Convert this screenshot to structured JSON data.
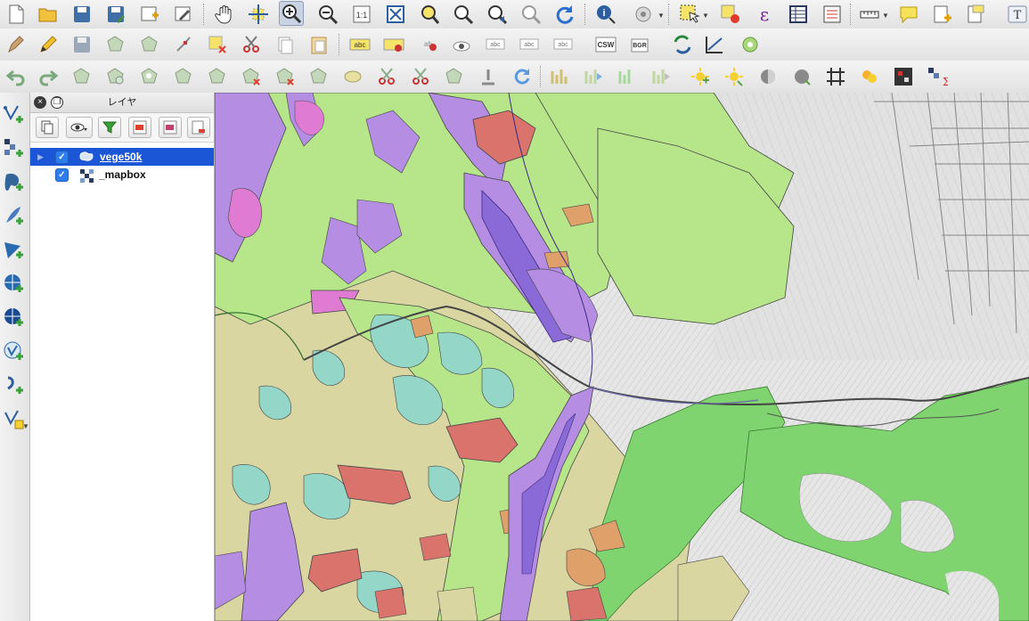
{
  "layers_panel": {
    "title": "レイヤ",
    "layers": [
      {
        "name": "vege50k",
        "checked": true,
        "selected": true,
        "icon": "polygon-layer-icon"
      },
      {
        "name": "_mapbox",
        "checked": true,
        "selected": false,
        "icon": "raster-layer-icon"
      }
    ]
  },
  "toolbar_top": {
    "labels": [
      "CSW",
      "BGR",
      "abc",
      "abc",
      "abc",
      "abc",
      "abc",
      "abc",
      "abc",
      "ε",
      "T"
    ]
  },
  "map": {
    "colors": {
      "light_green": "#b6e58a",
      "green": "#7fd46f",
      "purple": "#b58ee3",
      "violet": "#8a6ad6",
      "red": "#d9736b",
      "orange": "#e0a06a",
      "teal": "#94d6c8",
      "khaki": "#d9d6a2",
      "pink": "#e07bd4",
      "terrain": "#e3e3e3"
    }
  }
}
